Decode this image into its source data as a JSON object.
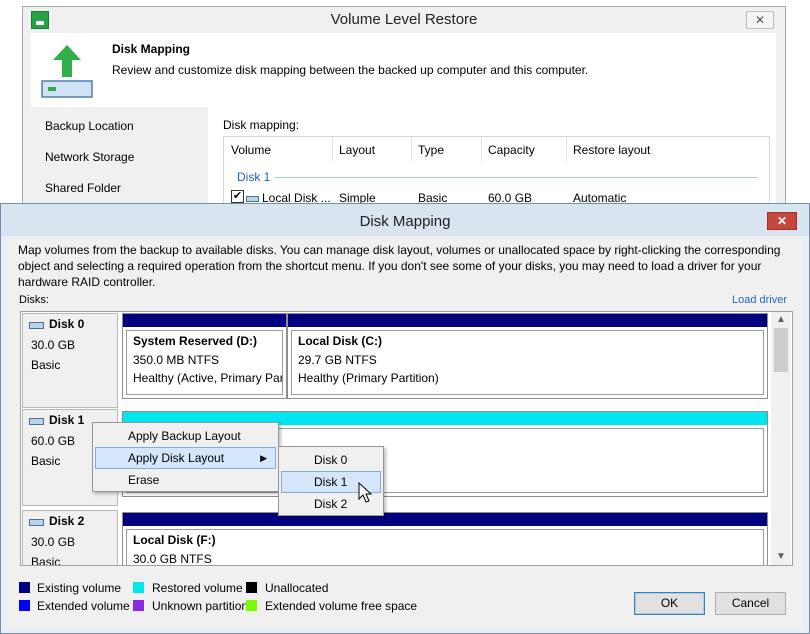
{
  "background_window": {
    "title": "Volume Level Restore",
    "close_label": "✕",
    "header_title": "Disk Mapping",
    "header_desc": "Review and customize disk mapping between the backed up computer and this computer.",
    "nav": [
      "Backup Location",
      "Network Storage",
      "Shared Folder"
    ],
    "mapping_label": "Disk mapping:",
    "columns": [
      "Volume",
      "Layout",
      "Type",
      "Capacity",
      "Restore layout"
    ],
    "group": "Disk 1",
    "row": {
      "volume": "Local Disk ...",
      "layout": "Simple",
      "type": "Basic",
      "capacity": "60.0 GB",
      "restore_layout": "Automatic"
    }
  },
  "dialog": {
    "title": "Disk Mapping",
    "close_label": "✕",
    "description": "Map volumes from the backup to available disks. You can manage disk layout, volumes or unallocated space by right-clicking the corresponding object and selecting a required operation from the shortcut menu. If you don't see some of your disks, you may need to load a driver for your hardware RAID controller.",
    "disks_label": "Disks:",
    "load_driver": "Load driver",
    "disks": [
      {
        "name": "Disk 0",
        "size": "30.0 GB",
        "type": "Basic",
        "volumes": [
          {
            "name": "System Reserved (D:)",
            "fs": "350.0 MB NTFS",
            "status": "Healthy (Active, Primary Par"
          },
          {
            "name": "Local Disk (C:)",
            "fs": "29.7 GB NTFS",
            "status": "Healthy (Primary Partition)"
          }
        ]
      },
      {
        "name": "Disk 1",
        "size": "60.0 GB",
        "type": "Basic"
      },
      {
        "name": "Disk 2",
        "size": "30.0 GB",
        "type": "Basic",
        "volumes": [
          {
            "name": "Local Disk (F:)",
            "fs": "30.0 GB NTFS"
          }
        ]
      }
    ],
    "context_menu": {
      "items": [
        "Apply Backup Layout",
        "Apply Disk Layout",
        "Erase"
      ],
      "highlighted": "Apply Disk Layout",
      "submenu": [
        "Disk 0",
        "Disk 1",
        "Disk 2"
      ],
      "submenu_highlighted": "Disk 1"
    },
    "legend": [
      {
        "label": "Existing volume",
        "color": "#000080"
      },
      {
        "label": "Restored volume",
        "color": "#00e5ee"
      },
      {
        "label": "Unallocated",
        "color": "#000000"
      },
      {
        "label": "Extended volume",
        "color": "#0000ff"
      },
      {
        "label": "Unknown partition",
        "color": "#8a2be2"
      },
      {
        "label": "Extended volume free space",
        "color": "#7cfc00"
      }
    ],
    "ok_label": "OK",
    "cancel_label": "Cancel"
  }
}
